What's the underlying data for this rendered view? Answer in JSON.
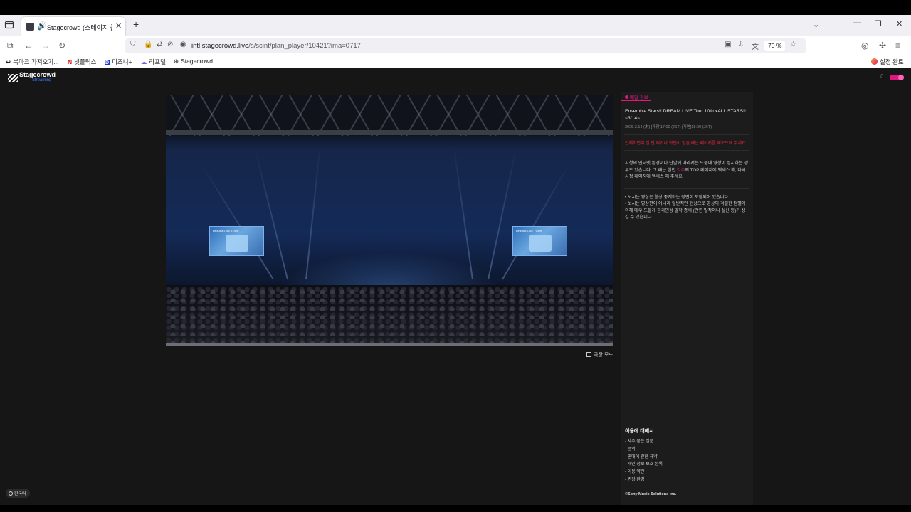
{
  "browser": {
    "tab": {
      "title": "Stagecrowd (스테이지 클라우드)"
    },
    "url": {
      "host": "intl.stagecrowd.live",
      "path": "/s/scint/plan_player/10421?ima=0717"
    },
    "zoom": "70 %",
    "bookmarks": [
      {
        "label": "북마크 가져오기...",
        "icon": "↩"
      },
      {
        "label": "넷플릭스",
        "icon": "N",
        "color": "#e50914"
      },
      {
        "label": "디즈니+",
        "icon": "D",
        "color": "#113ccf"
      },
      {
        "label": "라프텔",
        "icon": "☁",
        "color": "#7b5cf5"
      },
      {
        "label": "Stagecrowd",
        "icon": "⊕",
        "color": "#555555"
      }
    ],
    "settings_label": "설정 완료"
  },
  "site": {
    "logo_name": "Stagecrowd",
    "logo_sub": "Streaming",
    "accent": "#e0177f"
  },
  "player": {
    "theater_mode_label": "극장 모드",
    "screen_title": "DREAM LIVE TOUR"
  },
  "sidebar": {
    "tab_label": "배달 정보",
    "event_title": "Ensemble Stars!! DREAM LIVE Tour 10th xALL STARS!! ~3/14~",
    "event_date": "2025.3.14 (木) [개장]17:00 (JST) [개연]18:00 (JST)",
    "warning": "전체화면이 잘 안 되거나 화면이 멈출 때는 페이지를 재로드해 주세요",
    "para1_pre": "시청의 인터넷 환경이나 단말에 따라서는 도중에 영상이 정지하는 경우도 있습니다. 그 때는 한번 ",
    "para1_link": "각주",
    "para1_post": "의 TOP 페이지에 액세스 해, 다시 시청 페이지에 액세스 해 주세요.",
    "note1": "• 보시는 영상은 항상 중계하는 정면이 포함되어 있습니다",
    "note2": "• 보시는 영상편이 아니라 일반적인 현상으로 영상의 격렬한 점멸에 의해 매우 드물게 광과민성 발작 증세 (관련 발작이나 실신 등)가 생길 수 있습니다",
    "about_title": "이용에 대해서",
    "links": [
      "- 자주 묻는 질문",
      "- 문의",
      "- 판매에 관한 규약",
      "- 개인 정보 보호 정책",
      "- 이용 약관",
      "- 권장 환경"
    ],
    "copyright": "©Sony Music Solutions Inc."
  },
  "footer": {
    "language": "한국어"
  }
}
